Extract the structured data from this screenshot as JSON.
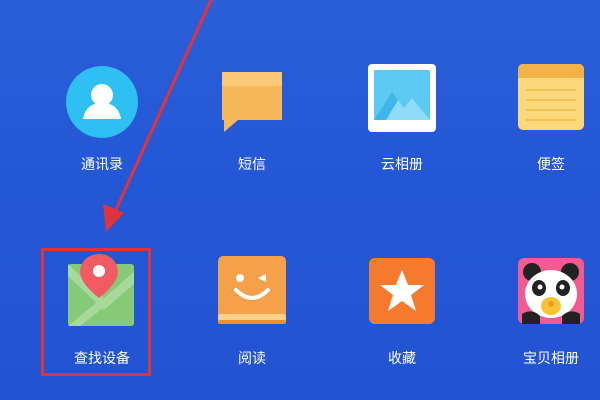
{
  "apps": [
    {
      "label": "通讯录",
      "icon": "contacts-icon"
    },
    {
      "label": "短信",
      "icon": "message-icon"
    },
    {
      "label": "云相册",
      "icon": "photo-album-icon"
    },
    {
      "label": "便签",
      "icon": "notes-icon"
    },
    {
      "label": "查找设备",
      "icon": "map-pin-icon"
    },
    {
      "label": "阅读",
      "icon": "reader-book-icon"
    },
    {
      "label": "收藏",
      "icon": "star-icon"
    },
    {
      "label": "宝贝相册",
      "icon": "panda-icon"
    }
  ],
  "colors": {
    "background": "#2457d6",
    "annotation": "#e0343a"
  }
}
